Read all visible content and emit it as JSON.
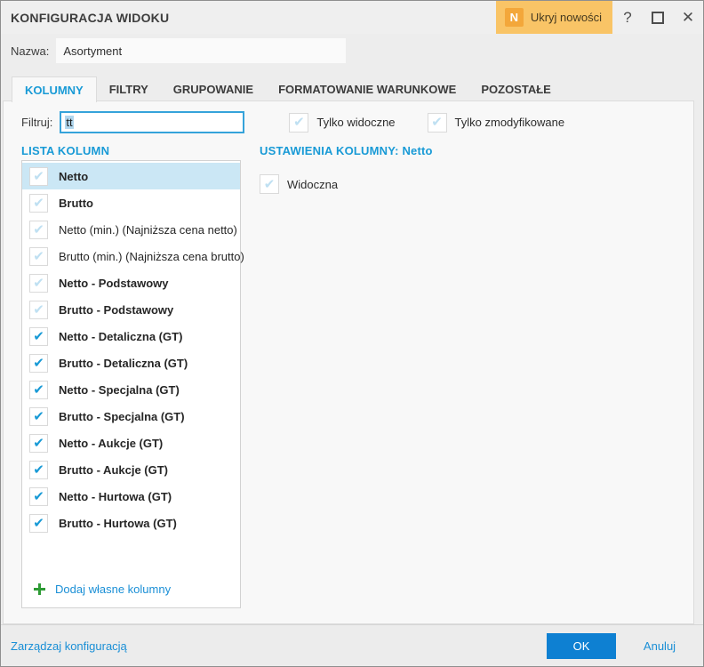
{
  "colors": {
    "accent_blue": "#189ad6",
    "ok_blue": "#0e80d2",
    "selected_row": "#cbe7f5",
    "news_button_bg": "#f9c466",
    "news_badge_bg": "#f3a73a"
  },
  "titlebar": {
    "title": "KONFIGURACJA WIDOKU",
    "news_button": {
      "badge": "N",
      "label": "Ukryj nowości"
    },
    "help_glyph": "?",
    "close_glyph": "✕"
  },
  "name_row": {
    "label": "Nazwa:",
    "value": "Asortyment"
  },
  "tabs": [
    {
      "label": "KOLUMNY",
      "active": true
    },
    {
      "label": "FILTRY",
      "active": false
    },
    {
      "label": "GRUPOWANIE",
      "active": false
    },
    {
      "label": "FORMATOWANIE WARUNKOWE",
      "active": false
    },
    {
      "label": "POZOSTAŁE",
      "active": false
    }
  ],
  "filter": {
    "label": "Filtruj:",
    "value": "tt"
  },
  "filter_checkboxes": [
    {
      "label": "Tylko widoczne",
      "checked": false
    },
    {
      "label": "Tylko zmodyfikowane",
      "checked": false
    }
  ],
  "column_list": {
    "heading": "LISTA KOLUMN",
    "items": [
      {
        "label": "Netto",
        "checked": false,
        "bold": true,
        "selected": true
      },
      {
        "label": "Brutto",
        "checked": false,
        "bold": true,
        "selected": false
      },
      {
        "label": "Netto (min.) (Najniższa cena netto)",
        "checked": false,
        "bold": false,
        "selected": false
      },
      {
        "label": "Brutto (min.) (Najniższa cena brutto)",
        "checked": false,
        "bold": false,
        "selected": false
      },
      {
        "label": "Netto - Podstawowy",
        "checked": false,
        "bold": true,
        "selected": false
      },
      {
        "label": "Brutto - Podstawowy",
        "checked": false,
        "bold": true,
        "selected": false
      },
      {
        "label": "Netto - Detaliczna (GT)",
        "checked": true,
        "bold": true,
        "selected": false
      },
      {
        "label": "Brutto - Detaliczna (GT)",
        "checked": true,
        "bold": true,
        "selected": false
      },
      {
        "label": "Netto - Specjalna (GT)",
        "checked": true,
        "bold": true,
        "selected": false
      },
      {
        "label": "Brutto - Specjalna (GT)",
        "checked": true,
        "bold": true,
        "selected": false
      },
      {
        "label": "Netto - Aukcje (GT)",
        "checked": true,
        "bold": true,
        "selected": false
      },
      {
        "label": "Brutto - Aukcje (GT)",
        "checked": true,
        "bold": true,
        "selected": false
      },
      {
        "label": "Netto - Hurtowa (GT)",
        "checked": true,
        "bold": true,
        "selected": false
      },
      {
        "label": "Brutto - Hurtowa (GT)",
        "checked": true,
        "bold": true,
        "selected": false
      }
    ],
    "add_link": "Dodaj własne kolumny"
  },
  "settings": {
    "heading": "USTAWIENIA KOLUMNY: Netto",
    "visible_label": "Widoczna"
  },
  "footer": {
    "manage_link": "Zarządzaj konfiguracją",
    "ok_label": "OK",
    "cancel_label": "Anuluj"
  }
}
